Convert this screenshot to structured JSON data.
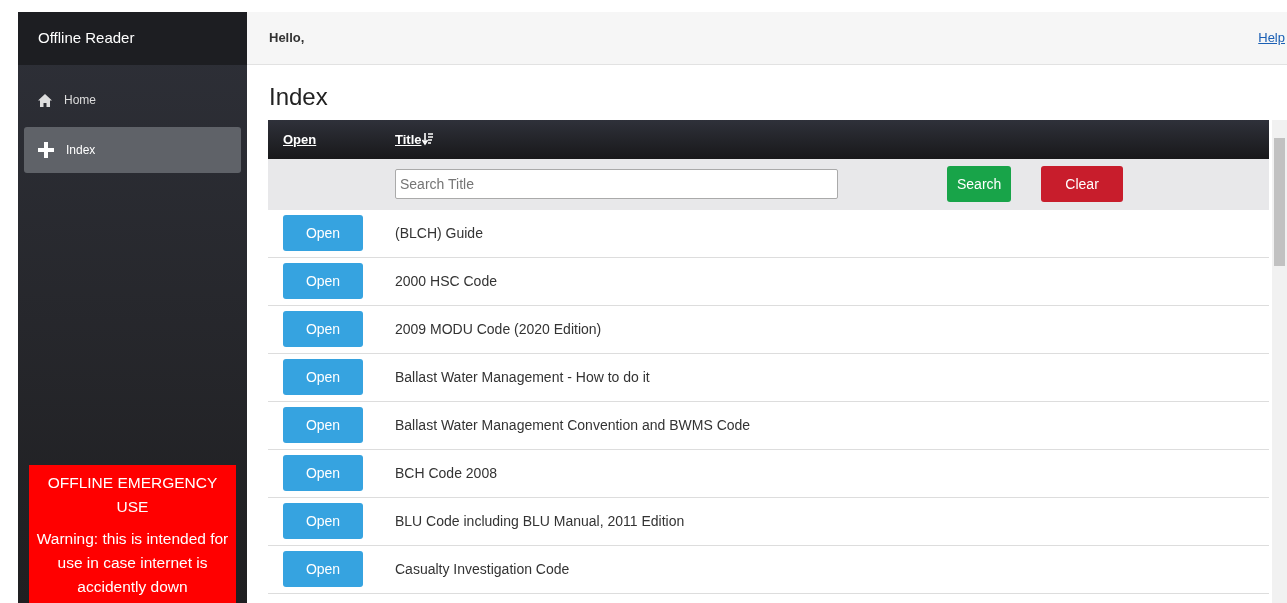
{
  "sidebar": {
    "brand": "Offline Reader",
    "items": [
      {
        "label": "Home",
        "kind": "home",
        "selected": false
      },
      {
        "label": "Index",
        "kind": "add",
        "selected": true
      }
    ],
    "alert": {
      "title": "OFFLINE EMERGENCY USE",
      "text": "Warning: this is intended for use in case internet is accidently down"
    }
  },
  "topbar": {
    "greeting": "Hello,",
    "help": "Help"
  },
  "page_title": "Index",
  "table": {
    "columns": [
      {
        "label": "Open",
        "sorted": false
      },
      {
        "label": "Title",
        "sorted": true
      }
    ],
    "search": {
      "placeholder": "Search Title",
      "search_button": "Search",
      "clear_button": "Clear"
    },
    "rows": [
      {
        "button": "Open",
        "title": "(BLCH) Guide"
      },
      {
        "button": "Open",
        "title": "2000 HSC Code"
      },
      {
        "button": "Open",
        "title": "2009 MODU Code (2020 Edition)"
      },
      {
        "button": "Open",
        "title": "Ballast Water Management - How to do it"
      },
      {
        "button": "Open",
        "title": "Ballast Water Management Convention and BWMS Code"
      },
      {
        "button": "Open",
        "title": "BCH Code 2008"
      },
      {
        "button": "Open",
        "title": "BLU Code including BLU Manual, 2011 Edition"
      },
      {
        "button": "Open",
        "title": "Casualty Investigation Code"
      }
    ]
  }
}
